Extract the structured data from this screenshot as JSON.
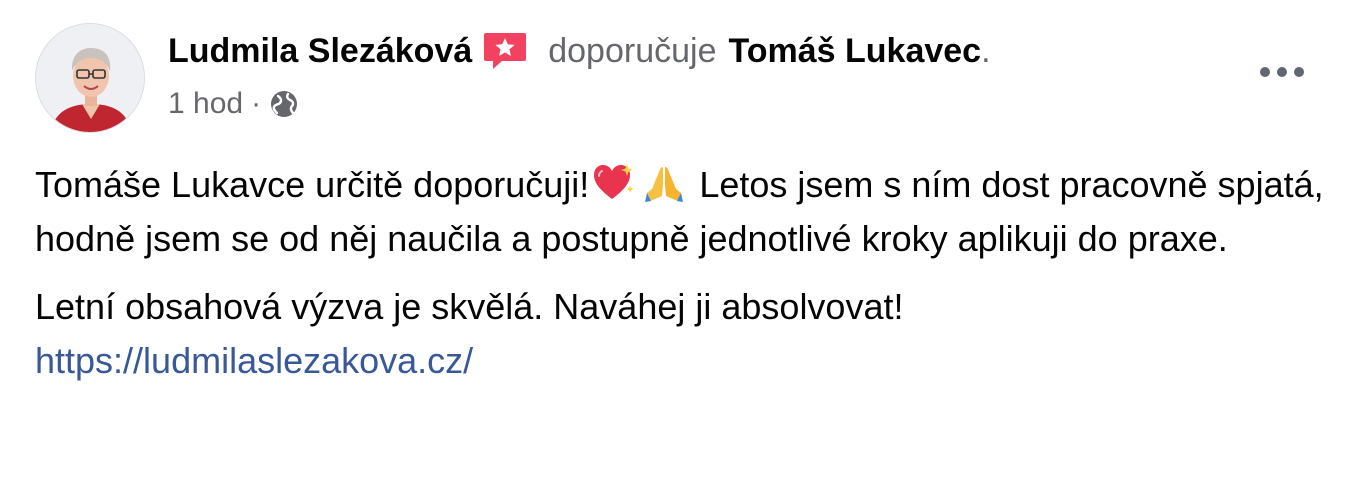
{
  "post": {
    "author": "Ludmila Slezáková",
    "verb": "doporučuje",
    "target": "Tomáš Lukavec",
    "period": ".",
    "time": "1 hod",
    "separator": "·",
    "paragraph1_part1": "Tomáše Lukavce určitě doporučuji!",
    "paragraph1_part2": "Letos jsem s ním dost pracovně spjatá, hodně jsem se od něj naučila a postupně jednotlivé kroky aplikuji do praxe.",
    "paragraph2_text": "Letní obsahová výzva je skvělá. Naváhej ji absolvovat!",
    "link": "https://ludmilaslezakova.cz/"
  },
  "icons": {
    "recommend_badge": "recommendation-star-icon",
    "audience": "globe-icon",
    "more": "more-options-icon",
    "emoji1": "sparkling-heart-icon",
    "emoji2": "folded-hands-icon"
  },
  "colors": {
    "text": "#050505",
    "secondary_text": "#65676b",
    "link": "#385898",
    "badge": "#f3425f"
  }
}
